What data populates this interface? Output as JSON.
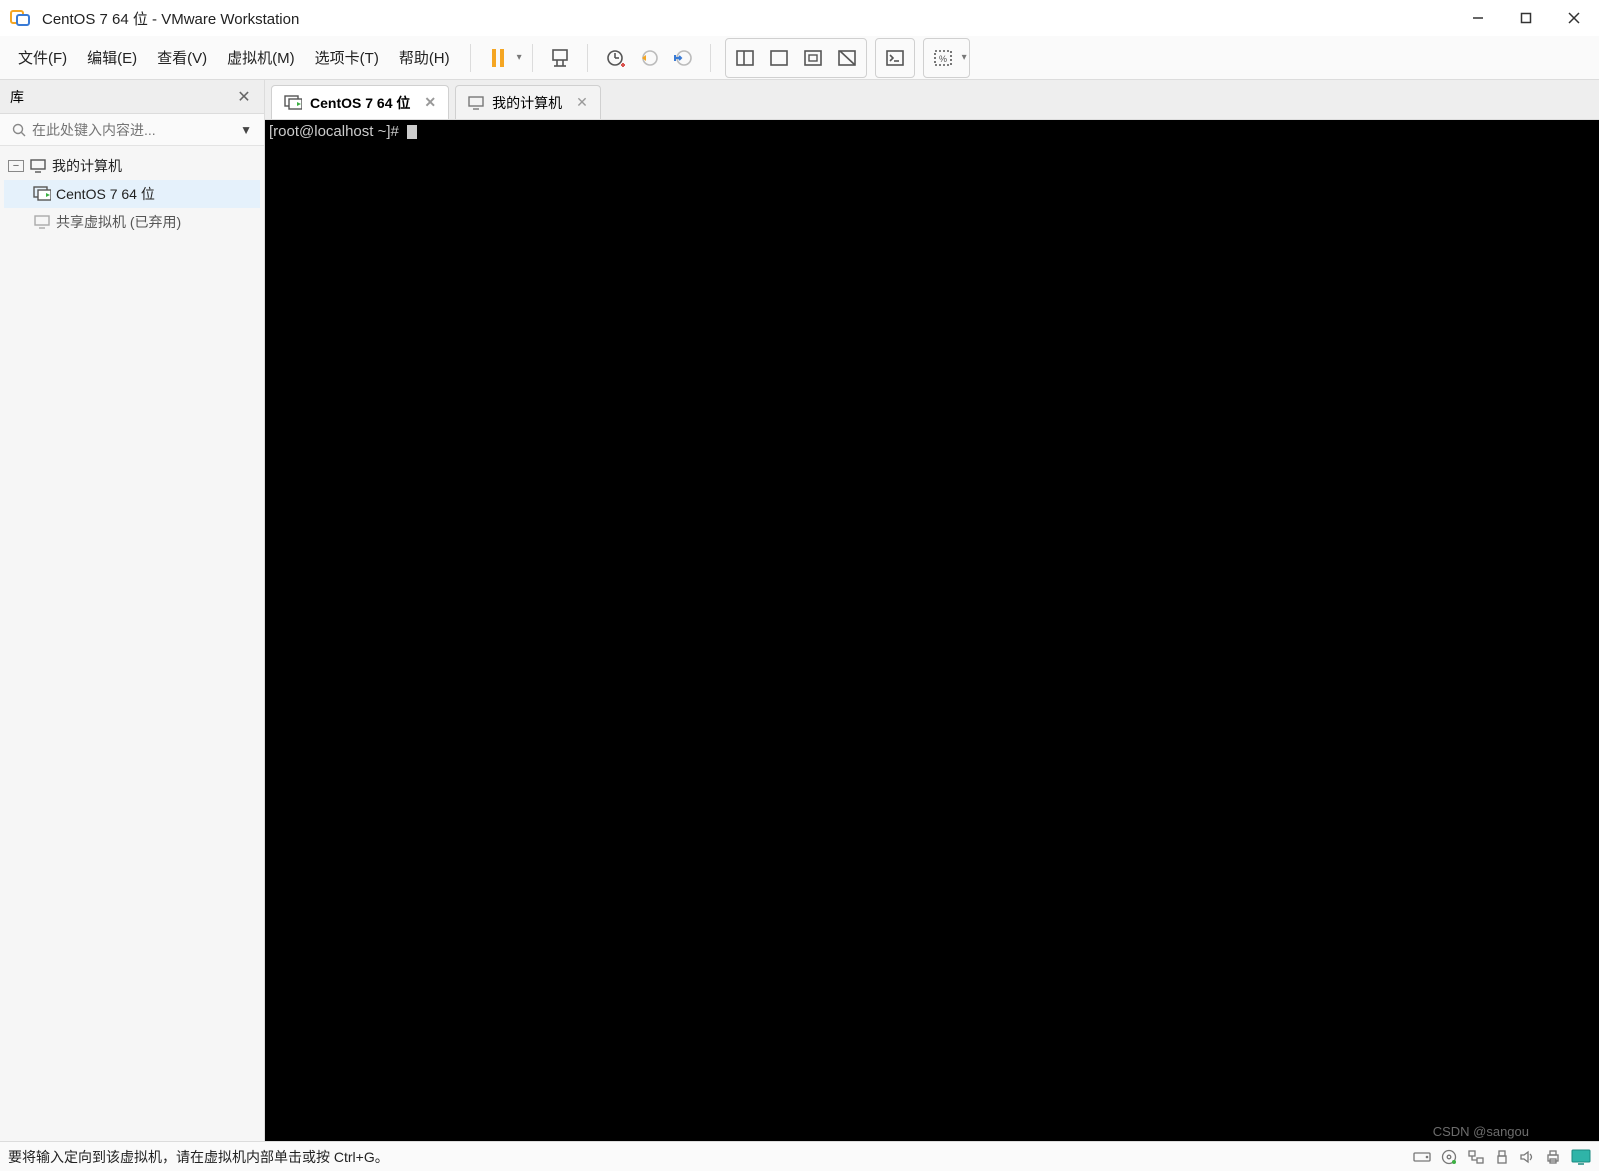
{
  "window": {
    "title": "CentOS 7 64 位 - VMware Workstation"
  },
  "menu": {
    "file": "文件(F)",
    "edit": "编辑(E)",
    "view": "查看(V)",
    "vm": "虚拟机(M)",
    "tabs": "选项卡(T)",
    "help": "帮助(H)"
  },
  "toolbar_icons": {
    "pause": "pause",
    "usb": "usb",
    "snapshot": "snapshot",
    "revert": "revert",
    "manage": "manage",
    "splitview": "splitview",
    "singleview": "singleview",
    "fullscreen": "fullscreen",
    "unity": "unity",
    "console": "console",
    "scale": "scale"
  },
  "sidebar": {
    "title": "库",
    "search_placeholder": "在此处键入内容进...",
    "tree": {
      "root_label": "我的计算机",
      "vm_label": "CentOS 7 64 位",
      "shared_label": "共享虚拟机 (已弃用)"
    }
  },
  "tabs": [
    {
      "label": "CentOS 7 64 位",
      "active": true,
      "icon": "vm-running"
    },
    {
      "label": "我的计算机",
      "active": false,
      "icon": "monitor"
    }
  ],
  "console": {
    "prompt": "[root@localhost ~]# "
  },
  "statusbar": {
    "message": "要将输入定向到该虚拟机，请在虚拟机内部单击或按 Ctrl+G。"
  },
  "watermark": "CSDN @sangou"
}
